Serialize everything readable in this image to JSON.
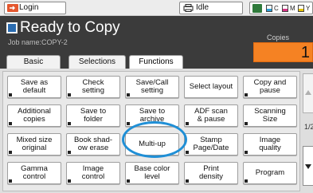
{
  "topbar": {
    "login_label": "Login",
    "status_label": "Idle",
    "toner": [
      {
        "letter": "C",
        "color": "#2a9fd6",
        "level": 0.5
      },
      {
        "letter": "M",
        "color": "#d63384",
        "level": 0.5
      },
      {
        "letter": "Y",
        "color": "#e6c200",
        "level": 0.5
      }
    ]
  },
  "header": {
    "title": "Ready to Copy",
    "job_name": "Job name:COPY-2",
    "copies_label": "Copies",
    "copies_value": "1"
  },
  "tabs": [
    {
      "label": "Basic"
    },
    {
      "label": "Selections"
    },
    {
      "label": "Functions"
    }
  ],
  "functions": [
    {
      "label": "Save as\ndefault"
    },
    {
      "label": "Check\nsetting"
    },
    {
      "label": "Save/Call\nsetting"
    },
    {
      "label": "Select layout"
    },
    {
      "label": "Copy and\npause"
    },
    {
      "label": "Additional\ncopies"
    },
    {
      "label": "Save to\nfolder"
    },
    {
      "label": "Save to\narchive"
    },
    {
      "label": "ADF scan\n& pause"
    },
    {
      "label": "Scanning\nSize"
    },
    {
      "label": "Mixed size\noriginal"
    },
    {
      "label": "Book shad-\now erase"
    },
    {
      "label": "Multi-up"
    },
    {
      "label": "Stamp\nPage/Date"
    },
    {
      "label": "Image\nquality"
    },
    {
      "label": "Gamma\ncontrol"
    },
    {
      "label": "Image\ncontrol"
    },
    {
      "label": "Base color\nlevel"
    },
    {
      "label": "Print\ndensity"
    },
    {
      "label": "Program"
    }
  ],
  "pager": {
    "indicator": "1/2"
  },
  "colors": {
    "accent": "#f58223",
    "highlight": "#1f8fd6",
    "header_bg": "#3b3b3b"
  }
}
